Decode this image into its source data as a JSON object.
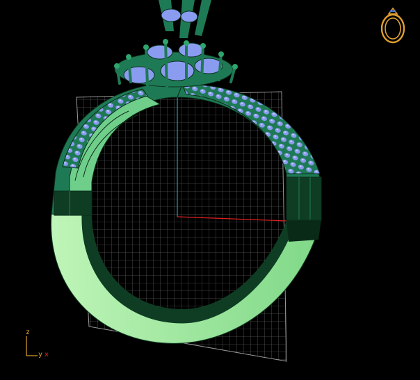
{
  "viewport": {
    "background": "#000000",
    "grid_color": "#8a8a8a",
    "axis_colors": {
      "x": "#e02020",
      "z": "#1fa0b8",
      "y": "#1fa0b8"
    },
    "model_colors": {
      "setting": "#1e7a55",
      "shank_light": "#9be59b",
      "shank_dark": "#0e3d23",
      "stones": "#8a9cf0"
    }
  },
  "axis_gizmo": {
    "z_label": "z",
    "y_label": "y",
    "x_label": "x",
    "colors": {
      "z": "#e0a030",
      "y": "#e0a030",
      "x": "#e02020"
    }
  },
  "view_cube": {
    "icon": "ring-icon",
    "color": "#e0a030"
  }
}
